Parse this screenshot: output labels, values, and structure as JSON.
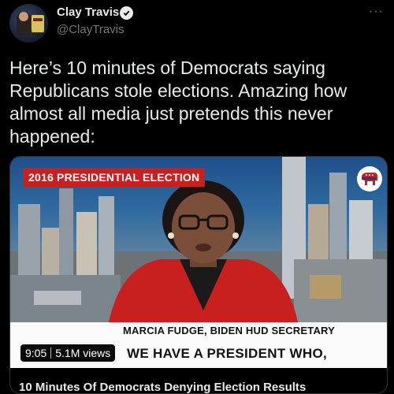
{
  "tweet": {
    "author_name": "Clay Travis",
    "author_handle": "@ClayTravis",
    "text": "Here’s 10 minutes of Democrats saying Republicans stole elections. Amazing how almost all media just pretends this never happened:",
    "more_label": "···"
  },
  "video": {
    "tag": "2016 PRESIDENTIAL ELECTION",
    "lower_third_name": "MARCIA FUDGE, BIDEN HUD SECRETARY",
    "lower_third_quote": "WE HAVE A PRESIDENT WHO,",
    "duration": "9:05",
    "views": "5.1M views",
    "title": "10 Minutes Of Democrats Denying Election Results"
  },
  "colors": {
    "background": "#000000",
    "text": "#e7e9ea",
    "muted": "#71767b",
    "tag_red": "#c8201f"
  }
}
